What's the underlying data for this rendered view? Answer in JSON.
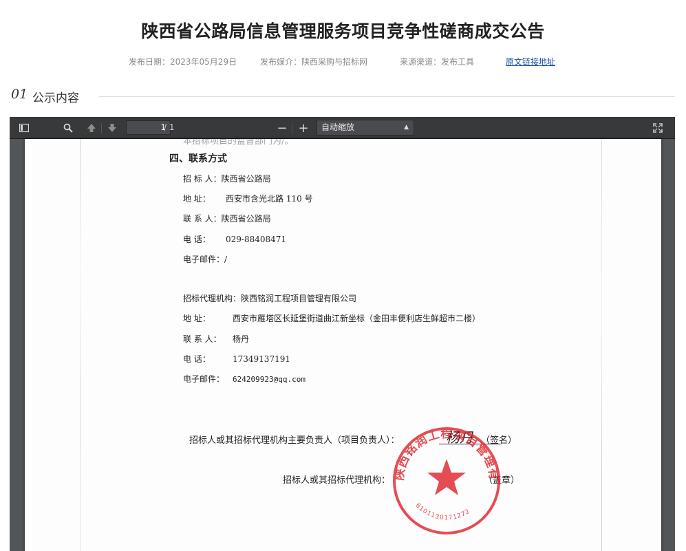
{
  "page_title": "陕西省公路局信息管理服务项目竞争性磋商成交公告",
  "meta": {
    "date_label": "发布日期：2023年05月29日",
    "media_label": "发布媒介：陕西采购与招标网",
    "source_label": "来源渠道：发布工具",
    "link_label": "原文链接地址"
  },
  "section": {
    "number": "01",
    "title": "公示内容"
  },
  "viewer": {
    "page_current": "1",
    "page_total": "/ 1",
    "zoom_selected": "自动缩放",
    "zoom_out": "−",
    "zoom_in": "+",
    "icons": [
      "sidebar-toggle-icon",
      "search-icon",
      "previous-page-icon",
      "next-page-icon",
      "fullscreen-icon"
    ]
  },
  "document": {
    "cut_line": "本招标项目的监督部门为/。",
    "heading": "四、联系方式",
    "tenderer": {
      "name_label": "招 标 人：",
      "name": "陕西省公路局",
      "address_label": "地 址：",
      "address": "西安市含光北路 110 号",
      "contact_label": "联 系 人：",
      "contact": "陕西省公路局",
      "phone_label": "电 话：",
      "phone": "029-88408471",
      "email_label": "电子邮件：",
      "email": "/"
    },
    "agency": {
      "name_label": "招标代理机构：",
      "name": "陕西铭润工程项目管理有限公司",
      "address_label": "地 址：",
      "address": "西安市雁塔区长延堡街道曲江新坐标（金田丰便利店生鲜超市二楼）",
      "contact_label": "联 系 人：",
      "contact": "杨丹",
      "phone_label": "电 话：",
      "phone": "17349137191",
      "email_label": "电子邮件：",
      "email": "624209923@qq.com"
    },
    "sign_line": "招标人或其招标代理机构主要负责人（项目负责人）：",
    "signature": "杨丹",
    "sign_suffix": "（签名）",
    "seal_line": "招标人或其招标代理机构：",
    "seal_suffix": "（盖章）",
    "stamp_text": "陕西铭润工程项目管理有限公司",
    "stamp_number": "6101130171272"
  },
  "colors": {
    "link": "#1a4fa0",
    "viewer_bg": "#525659",
    "toolbar_bg": "#38393b",
    "stamp": "#e0262e"
  }
}
